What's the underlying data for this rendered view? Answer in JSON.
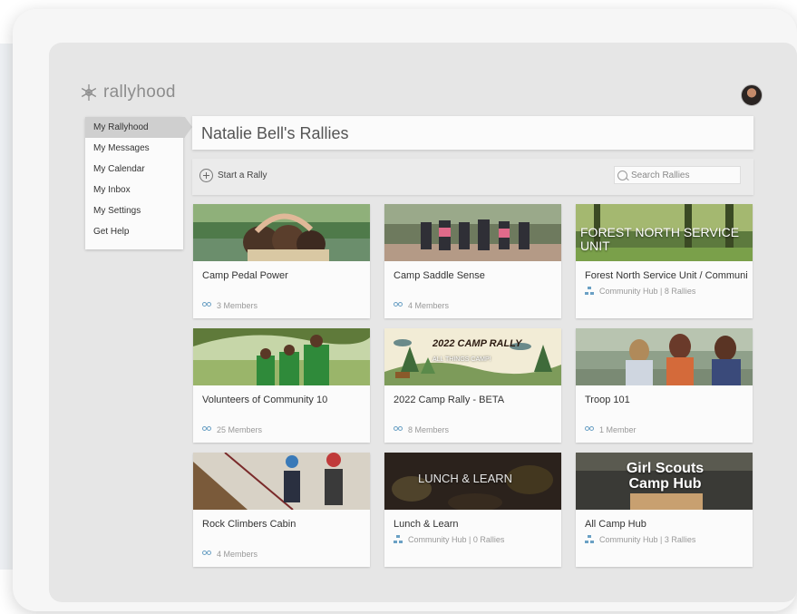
{
  "app": {
    "logo_text": "rallyhood"
  },
  "sidebar": {
    "items": [
      {
        "label": "My Rallyhood",
        "active": true
      },
      {
        "label": "My Messages"
      },
      {
        "label": "My Calendar"
      },
      {
        "label": "My Inbox"
      },
      {
        "label": "My Settings"
      },
      {
        "label": "Get Help"
      }
    ]
  },
  "header": {
    "title": "Natalie Bell's Rallies"
  },
  "toolbar": {
    "start_label": "Start a Rally",
    "search_placeholder": "Search Rallies"
  },
  "cards": [
    {
      "title": "Camp Pedal Power",
      "meta": "3 Members",
      "meta_type": "members"
    },
    {
      "title": "Camp Saddle Sense",
      "meta": "4 Members",
      "meta_type": "members"
    },
    {
      "title": "Forest North Service Unit / Community Hub",
      "meta": "Community Hub | 8 Rallies",
      "meta_type": "hub",
      "image_text": "FOREST NORTH SERVICE UNIT"
    },
    {
      "title": "Volunteers of Community 10",
      "meta": "25 Members",
      "meta_type": "members"
    },
    {
      "title": "2022 Camp Rally - BETA",
      "meta": "8 Members",
      "meta_type": "members",
      "image_text": "2022 CAMP RALLY",
      "image_subtext": "ALL THINGS CAMP!"
    },
    {
      "title": "Troop 101",
      "meta": "1 Member",
      "meta_type": "members"
    },
    {
      "title": "Rock Climbers Cabin",
      "meta": "4 Members",
      "meta_type": "members"
    },
    {
      "title": "Lunch & Learn",
      "meta": "Community Hub | 0 Rallies",
      "meta_type": "hub",
      "image_text": "LUNCH & LEARN"
    },
    {
      "title": "All Camp Hub",
      "meta": "Community Hub | 3 Rallies",
      "meta_type": "hub",
      "image_text": "Girl Scouts Camp Hub"
    }
  ],
  "colors": {
    "accent": "#6aa0c4",
    "screen_bg": "#e6e6e6",
    "active_nav": "#cfcfcf"
  }
}
